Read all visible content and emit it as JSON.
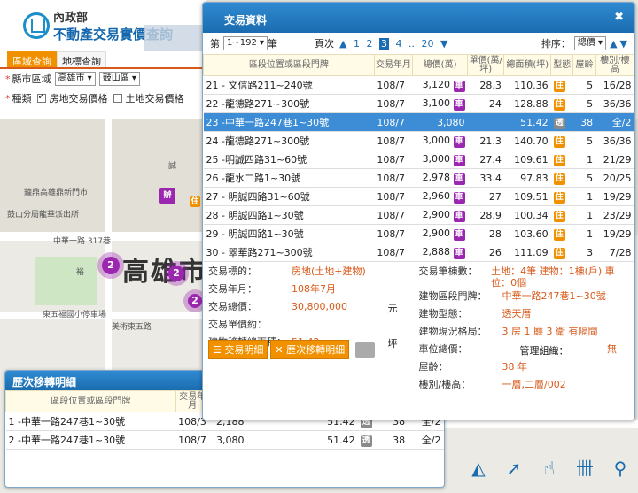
{
  "header": {
    "org": "內政部",
    "title": "不動產交易實價查詢"
  },
  "tabs": [
    {
      "label": "區域查詢"
    },
    {
      "label": "地標查詢"
    }
  ],
  "filters": {
    "area_label": "縣市區域",
    "city": "高雄市",
    "district": "鼓山區",
    "type_label": "種類",
    "opt1": "房地交易價格",
    "opt2": "土地交易價格"
  },
  "map_labels": {
    "city": "高雄市",
    "poi1": "鐘鼎高雄鼎新門市",
    "poi2": "鼓山分局龍華派出所",
    "road1": "中華一路 317巷",
    "road2": "裕",
    "road3": "誠",
    "park": "東五福國小停車場",
    "road4": "美術東五路",
    "road5": "上"
  },
  "clusters": [
    "2",
    "2",
    "2"
  ],
  "poi_badges": [
    "辦",
    "住"
  ],
  "main": {
    "title": "交易資料",
    "page_prefix": "第",
    "page_select": "1~192",
    "page_suffix": "筆",
    "pages_label": "頁次",
    "pages": [
      "1",
      "2",
      "3",
      "4",
      "..",
      "20"
    ],
    "sort_label": "排序：",
    "sort_value": "總價"
  },
  "columns": [
    "區段位置或區段門牌",
    "交易年月",
    "總價(萬)",
    "單價(萬/坪)",
    "總面積(坪)",
    "型態",
    "屋齡",
    "樓別/樓高"
  ],
  "rows": [
    {
      "no": "21",
      "addr": "- 文信路211~240號",
      "ym": "108/7",
      "total": "3,120",
      "ic": "車",
      "unit": "28.3",
      "area": "110.36",
      "ty": "住",
      "age": "5",
      "fl": "16/28"
    },
    {
      "no": "22",
      "addr": "-龍德路271~300號",
      "ym": "108/7",
      "total": "3,100",
      "ic": "車",
      "unit": "24",
      "area": "128.88",
      "ty": "住",
      "age": "5",
      "fl": "36/36"
    },
    {
      "no": "23",
      "addr": "-中華一路247巷1~30號",
      "ym": "108/7",
      "total": "3,080",
      "ic": "",
      "unit": "",
      "area": "51.42",
      "ty": "透",
      "age": "38",
      "fl": "全/2"
    },
    {
      "no": "24",
      "addr": "-龍德路271~300號",
      "ym": "108/7",
      "total": "3,000",
      "ic": "車",
      "unit": "21.3",
      "area": "140.70",
      "ty": "住",
      "age": "5",
      "fl": "36/36"
    },
    {
      "no": "25",
      "addr": "-明誠四路31~60號",
      "ym": "108/7",
      "total": "3,000",
      "ic": "車",
      "unit": "27.4",
      "area": "109.61",
      "ty": "住",
      "age": "1",
      "fl": "21/29"
    },
    {
      "no": "26",
      "addr": "-龍水二路1~30號",
      "ym": "108/7",
      "total": "2,978",
      "ic": "車",
      "unit": "33.4",
      "area": "97.83",
      "ty": "住",
      "age": "5",
      "fl": "20/25"
    },
    {
      "no": "27",
      "addr": "- 明誠四路31~60號",
      "ym": "108/7",
      "total": "2,960",
      "ic": "車",
      "unit": "27",
      "area": "109.51",
      "ty": "住",
      "age": "1",
      "fl": "19/29"
    },
    {
      "no": "28",
      "addr": "- 明誠四路1~30號",
      "ym": "108/7",
      "total": "2,900",
      "ic": "車",
      "unit": "28.9",
      "area": "100.34",
      "ty": "住",
      "age": "1",
      "fl": "23/29"
    },
    {
      "no": "29",
      "addr": "- 明誠四路1~30號",
      "ym": "108/7",
      "total": "2,900",
      "ic": "車",
      "unit": "28",
      "area": "103.60",
      "ty": "住",
      "age": "1",
      "fl": "19/29"
    },
    {
      "no": "30",
      "addr": "- 翠華路271~300號",
      "ym": "108/7",
      "total": "2,888",
      "ic": "車",
      "unit": "26",
      "area": "111.09",
      "ty": "住",
      "age": "3",
      "fl": "7/28"
    }
  ],
  "detail": {
    "left": [
      {
        "label": "交易標的：",
        "value": "房地(土地+建物)",
        "unit": ""
      },
      {
        "label": "交易年月：",
        "value": "108年7月",
        "unit": ""
      },
      {
        "label": "交易總價：",
        "value": "30,800,000",
        "unit": "元"
      },
      {
        "label": "交易單價約：",
        "value": "",
        "unit": ""
      },
      {
        "label": "建物移轉總面積：",
        "value": "51.42",
        "unit": "坪"
      }
    ],
    "right": [
      {
        "label": "交易筆棟數：",
        "value": "土地：4筆 建物：1棟(戶) 車位：0個"
      },
      {
        "label": "建物區段門牌：",
        "value": "中華一路247巷1~30號"
      },
      {
        "label": "建物型態：",
        "value": "透天厝"
      },
      {
        "label": "建物現況格局：",
        "value": "3 房 1 廳 3 衛 有隔間"
      },
      {
        "label": "車位總價：",
        "value": "",
        "extra_label": "管理組織：",
        "extra_value": "無"
      },
      {
        "label": "屋齡：",
        "value": "38 年"
      },
      {
        "label": "樓別/樓高：",
        "value": "一層,二層/002"
      }
    ],
    "btn1": "交易明細",
    "btn2": "歷次移轉明細"
  },
  "history": {
    "title": "歷次移轉明細",
    "columns": [
      "區段位置或區段門牌",
      "交易年月",
      "總價(萬)",
      "單價(萬/坪)",
      "總面積(坪)",
      "型態",
      "屋齡",
      "樓別/樓高"
    ],
    "rows": [
      {
        "no": "1",
        "addr": "-中華一路247巷1~30號",
        "ym": "108/3",
        "total": "2,188",
        "unit": "",
        "area": "51.42",
        "ty": "透",
        "age": "38",
        "fl": "全/2"
      },
      {
        "no": "2",
        "addr": "-中華一路247巷1~30號",
        "ym": "108/7",
        "total": "3,080",
        "unit": "",
        "area": "51.42",
        "ty": "透",
        "age": "38",
        "fl": "全/2"
      }
    ]
  },
  "toolbar": [
    "measure-icon",
    "cursor-icon",
    "touch-icon",
    "ruler-icon",
    "pin-icon"
  ],
  "colors": {
    "accent": "#1b6cb0",
    "orange": "#f29100",
    "highlight": "#3c8dd6",
    "cluster": "#9b27b0"
  }
}
